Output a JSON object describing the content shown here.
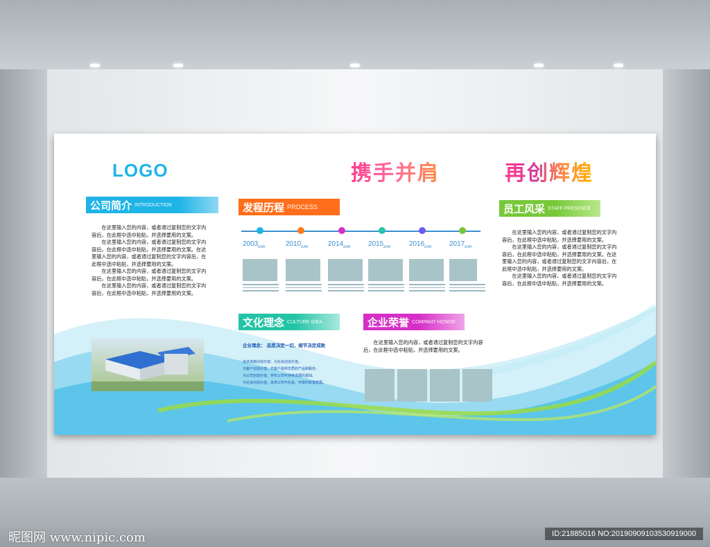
{
  "slogan": [
    "携手并肩",
    "再创辉煌"
  ],
  "logo": "LOGO",
  "company_intro": {
    "title": "公司简介",
    "subtitle": "INTRODUCTION",
    "paragraphs": [
      "在这里输入您的内容，或者通过复制您的文字内容后，在此框中选中粘贴，并选择要用的文案。",
      "在这里输入您的内容，或者通过复制您的文字内容后，在此框中选中粘贴，并选择要用的文案。在这里输入您的内容，或者通过复制您的文字内容后，在此框中选中粘贴，并选择要用的文案。",
      "在这里输入您的内容，或者通过复制您的文字内容后，在此框中选中粘贴，并选择要用的文案。",
      "在这里输入您的内容，或者通过复制您的文字内容后，在此框中选中粘贴，并选择要用的文案。"
    ]
  },
  "history": {
    "title": "发程历程",
    "subtitle": "PROCESS",
    "year_suffix": "EAR",
    "years": [
      "2003",
      "2010",
      "2014",
      "2015",
      "2016",
      "2017"
    ],
    "dot_colors": [
      "#1fb4e6",
      "#ff7a1a",
      "#d52fc7",
      "#28c3a8",
      "#6a5cf0",
      "#78c83a"
    ]
  },
  "culture": {
    "title": "文化理念",
    "subtitle": "CULTURE IDEA",
    "motto": "企业理念：  态度决定一切，细节决定成败",
    "lines": [
      "追求卓越创造价值：为社会创造价值。",
      "为客户创造价值，向客户提供优质的产品和服务。",
      "为公司创造价值，夯实公司可持续发展的基础。",
      "为社会创造价值，追求公司与社会、环境的和谐发展。"
    ]
  },
  "honor": {
    "title": "企业荣誉",
    "subtitle": "COMPANY HONOR",
    "text": "在这里输入您的内容，或者通过复制您的文字内容后，在此框中选中粘贴，并选择要用的文案。"
  },
  "staff": {
    "title": "员工风采",
    "subtitle": "STAFF PRESENCE",
    "paragraphs": [
      "在这里输入您的内容，或者通过复制您的文字内容后，在此框中选中粘贴，并选择要用的文案。",
      "在这里输入您的内容，或者通过复制您的文字内容后，在此框中选中粘贴，并选择要用的文案。在这里输入您的内容，或者通过复制您的文字内容后，在此框中选中粘贴，并选择要用的文案。",
      "在这里输入您的内容，或者通过复制您的文字内容后，在此框中选中粘贴，并选择要用的文案。"
    ]
  },
  "watermark": {
    "left": "昵图网 www.nipic.com",
    "right": "ID:21885016 NO:20190909103530919000"
  }
}
